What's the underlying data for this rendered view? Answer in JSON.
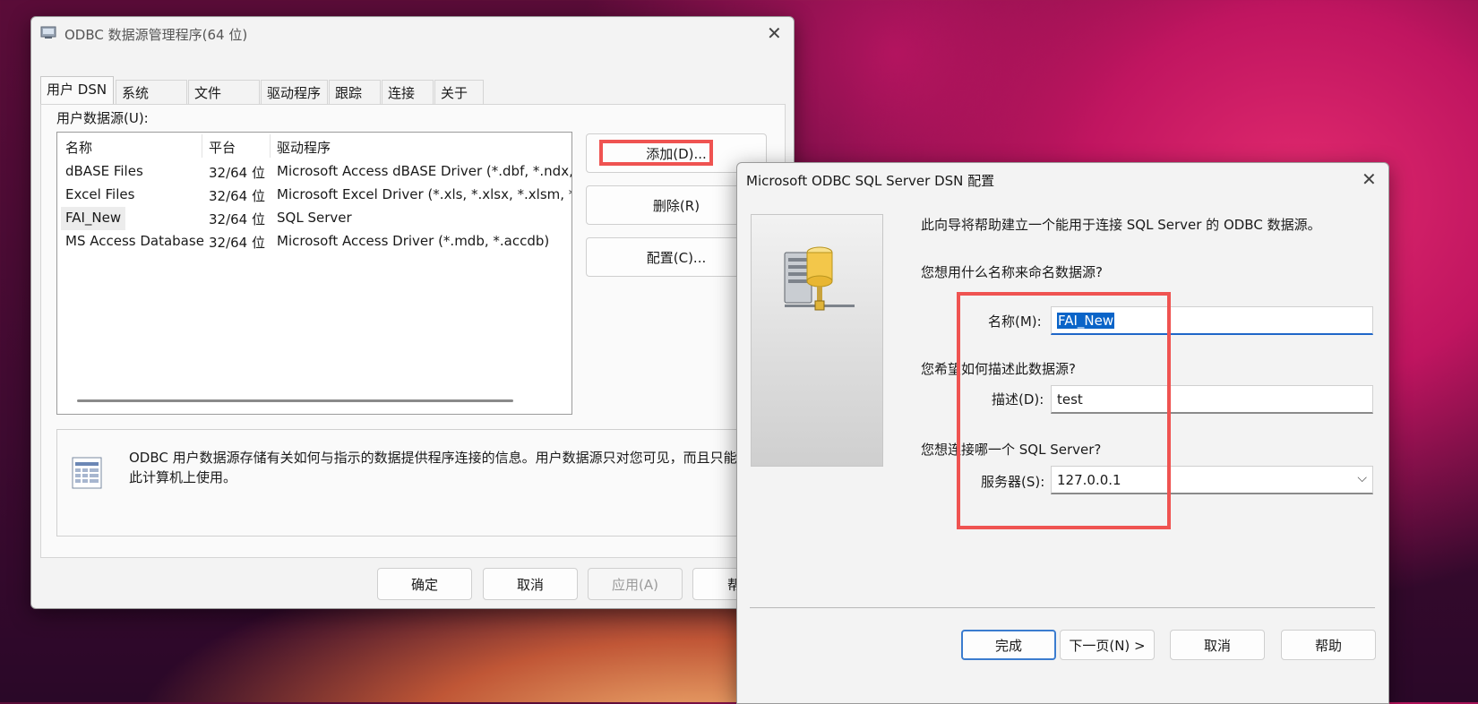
{
  "odbc_admin": {
    "title": "ODBC 数据源管理程序(64 位)",
    "tabs": [
      "用户 DSN",
      "系统 DSN",
      "文件 DSN",
      "驱动程序",
      "跟踪",
      "连接池",
      "关于"
    ],
    "list_label": "用户数据源(U):",
    "columns": [
      "名称",
      "平台",
      "驱动程序"
    ],
    "rows": [
      {
        "name": "dBASE Files",
        "platform": "32/64 位",
        "driver": "Microsoft Access dBASE Driver (*.dbf, *.ndx, *"
      },
      {
        "name": "Excel Files",
        "platform": "32/64 位",
        "driver": "Microsoft Excel Driver (*.xls, *.xlsx, *.xlsm, *.xls"
      },
      {
        "name": "FAI_New",
        "platform": "32/64 位",
        "driver": "SQL Server"
      },
      {
        "name": "MS Access Database",
        "platform": "32/64 位",
        "driver": "Microsoft Access Driver (*.mdb, *.accdb)"
      }
    ],
    "add_label": "添加(D)...",
    "remove_label": "删除(R)",
    "configure_label": "配置(C)...",
    "info_text_line1": "ODBC 用户数据源存储有关如何与指示的数据提供程序连接的信息。用户数据源只对您可见，而且只能在",
    "info_text_line2": "此计算机上使用。",
    "ok_label": "确定",
    "cancel_label": "取消",
    "apply_label": "应用(A)",
    "help_label": "帮"
  },
  "dsn_config": {
    "title": "Microsoft ODBC SQL Server DSN 配置",
    "intro": "此向导将帮助建立一个能用于连接 SQL Server 的 ODBC 数据源。",
    "q_name": "您想用什么名称来命名数据源?",
    "name_label": "名称(M):",
    "name_value": "FAI_New",
    "q_desc": "您希望如何描述此数据源?",
    "desc_label": "描述(D):",
    "desc_value": "test",
    "q_server": "您想连接哪一个 SQL Server?",
    "server_label": "服务器(S):",
    "server_value": "127.0.0.1",
    "finish_label": "完成",
    "next_label": "下一页(N) >",
    "cancel_label": "取消",
    "help_label": "帮助"
  },
  "colors": {
    "highlight_red": "#ef5351",
    "accent_blue": "#3b7ccf",
    "selection_blue": "#0a64c8"
  }
}
